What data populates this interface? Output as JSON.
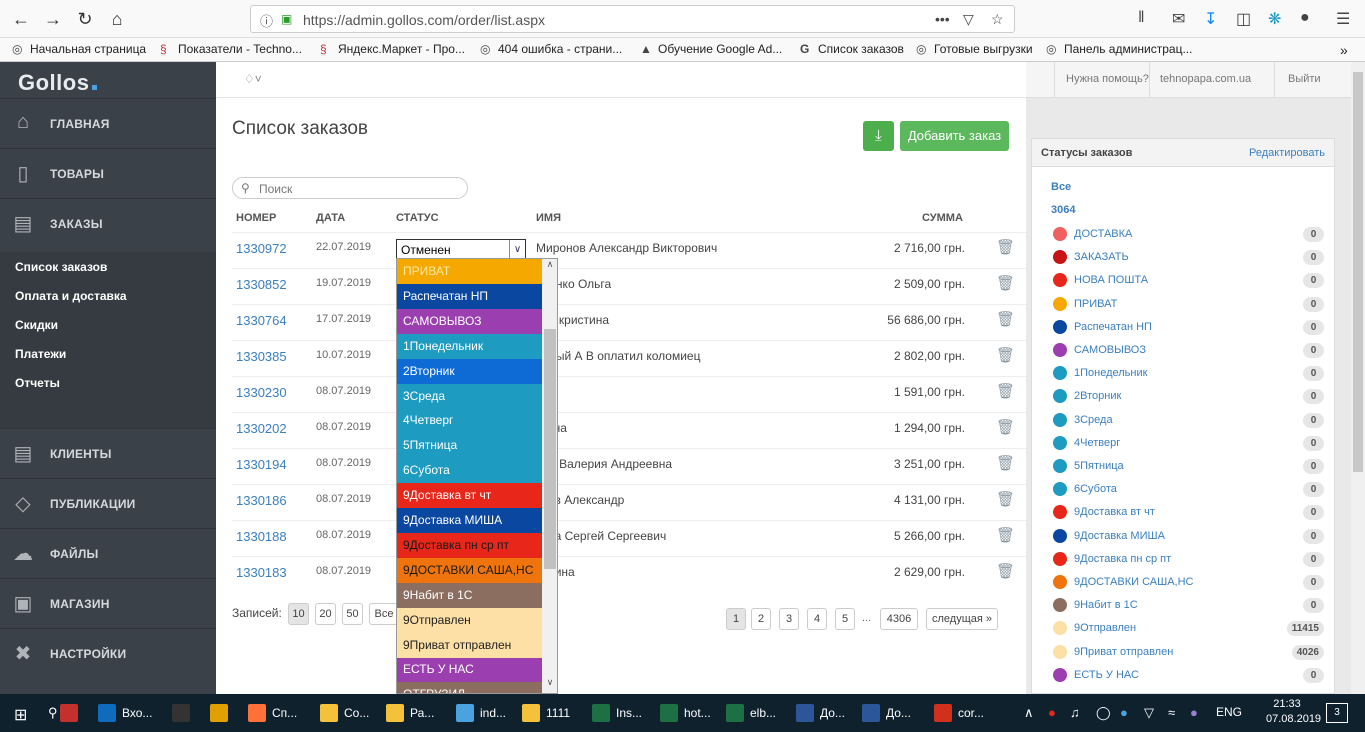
{
  "browser": {
    "url": "https://admin.gollos.com/order/list.aspx",
    "bookmarks": [
      {
        "label": "Начальная страница"
      },
      {
        "label": "Показатели - Techno..."
      },
      {
        "label": "Яндекс.Маркет - Про..."
      },
      {
        "label": "404 ошибка - страни..."
      },
      {
        "label": "Обучение Google Ad..."
      },
      {
        "label": "Список заказов"
      },
      {
        "label": "Готовые выгрузки"
      },
      {
        "label": "Панель администрац..."
      }
    ]
  },
  "sidebar": {
    "logo": "Gollos",
    "nav": [
      {
        "label": "ГЛАВНАЯ",
        "icon": "home-icon"
      },
      {
        "label": "ТОВАРЫ",
        "icon": "document-icon"
      },
      {
        "label": "ЗАКАЗЫ",
        "icon": "cart-icon"
      },
      {
        "label": "КЛИЕНТЫ",
        "icon": "client-card-icon"
      },
      {
        "label": "ПУБЛИКАЦИИ",
        "icon": "tag-icon"
      },
      {
        "label": "ФАЙЛЫ",
        "icon": "cloud-icon"
      },
      {
        "label": "МАГАЗИН",
        "icon": "store-icon"
      },
      {
        "label": "НАСТРОЙКИ",
        "icon": "wrench-icon"
      }
    ],
    "subnav": [
      "Список заказов",
      "Оплата и доставка",
      "Скидки",
      "Платежи",
      "Отчеты"
    ]
  },
  "header": {
    "help": "Нужна помощь?",
    "site": "tehnopapa.com.ua",
    "logout": "Выйти"
  },
  "page": {
    "title": "Список заказов",
    "add_button": "Добавить заказ",
    "search_placeholder": "Поиск",
    "columns": [
      "НОМЕР",
      "ДАТА",
      "СТАТУС",
      "ИМЯ",
      "СУММА"
    ],
    "orders": [
      {
        "num": "1330972",
        "date": "22.07.2019",
        "name": "Миронов Александр Викторович",
        "sum": "2 716,00 грн."
      },
      {
        "num": "1330852",
        "date": "19.07.2019",
        "name": "дченко Ольга",
        "sum": "2 509,00 грн."
      },
      {
        "num": "1330764",
        "date": "17.07.2019",
        "name": "арь кристина",
        "sum": "56 686,00 грн."
      },
      {
        "num": "1330385",
        "date": "10.07.2019",
        "name": "льный А В оплатил коломиец",
        "sum": "2 802,00 грн."
      },
      {
        "num": "1330230",
        "date": "08.07.2019",
        "name": "ис",
        "sum": "1 591,00 грн."
      },
      {
        "num": "1330202",
        "date": "08.07.2019",
        "name": "ягина",
        "sum": "1 294,00 грн."
      },
      {
        "num": "1330194",
        "date": "08.07.2019",
        "name": "пан Валерия Андреевна",
        "sum": "3 251,00 грн."
      },
      {
        "num": "1330186",
        "date": "08.07.2019",
        "name": "яков Александр",
        "sum": "4 131,00 грн."
      },
      {
        "num": "1330188",
        "date": "08.07.2019",
        "name": "авка Сергей Сергеевич",
        "sum": "5 266,00 грн."
      },
      {
        "num": "1330183",
        "date": "08.07.2019",
        "name": "терина",
        "sum": "2 629,00 грн."
      }
    ],
    "selected_status": "Отменен",
    "dropdown_options": [
      {
        "label": "ПРИВАТ",
        "bg": "#f5a800",
        "fg": "#f5e8a8"
      },
      {
        "label": "Распечатан НП",
        "bg": "#0a47a0",
        "fg": "#ffffff"
      },
      {
        "label": "САМОВЫВОЗ",
        "bg": "#9b3fb0",
        "fg": "#ffffff"
      },
      {
        "label": "1Понедельник",
        "bg": "#1e9bc0",
        "fg": "#ffffff"
      },
      {
        "label": "2Вторник",
        "bg": "#0e6bd6",
        "fg": "#ffffff"
      },
      {
        "label": "3Среда",
        "bg": "#1e9bc0",
        "fg": "#ffffff"
      },
      {
        "label": "4Четверг",
        "bg": "#1e9bc0",
        "fg": "#ffffff"
      },
      {
        "label": "5Пятница",
        "bg": "#1e9bc0",
        "fg": "#ffffff"
      },
      {
        "label": "6Субота",
        "bg": "#1e9bc0",
        "fg": "#ffffff"
      },
      {
        "label": "9Доставка вт чт",
        "bg": "#e8261a",
        "fg": "#ffffff"
      },
      {
        "label": "9Доставка МИША",
        "bg": "#0a47a0",
        "fg": "#ffffff"
      },
      {
        "label": "9Доставка пн ср пт",
        "bg": "#e8261a",
        "fg": "#1a1a1a"
      },
      {
        "label": "9ДОСТАВКИ САША,НС",
        "bg": "#f0740e",
        "fg": "#1a1a1a"
      },
      {
        "label": "9Набит в 1С",
        "bg": "#8c6e60",
        "fg": "#ffffff"
      },
      {
        "label": "9Отправлен",
        "bg": "#fde0a6",
        "fg": "#222222"
      },
      {
        "label": "9Приват отправлен",
        "bg": "#fde0a6",
        "fg": "#222222"
      },
      {
        "label": "ЕСТЬ У НАС",
        "bg": "#9b3fb0",
        "fg": "#ffffff"
      },
      {
        "label": "ОТГРУЗИЛ",
        "bg": "#8c6e60",
        "fg": "#ffffff"
      }
    ],
    "records_label": "Записей:",
    "page_sizes": [
      "10",
      "20",
      "50",
      "Все"
    ],
    "pagination": [
      "1",
      "2",
      "3",
      "4",
      "5",
      "4306"
    ],
    "ellipsis": "...",
    "next": "следущая »"
  },
  "statuses": {
    "title": "Статусы заказов",
    "edit": "Редактировать",
    "all": "Все",
    "total": "3064",
    "items": [
      {
        "name": "ДОСТАВКА",
        "color": "#f06060",
        "count": "0"
      },
      {
        "name": "ЗАКАЗАТЬ",
        "color": "#c81414",
        "count": "0"
      },
      {
        "name": "НОВА ПОШТА",
        "color": "#e8261a",
        "count": "0"
      },
      {
        "name": "ПРИВАТ",
        "color": "#f5a800",
        "count": "0"
      },
      {
        "name": "Распечатан НП",
        "color": "#0a47a0",
        "count": "0"
      },
      {
        "name": "САМОВЫВОЗ",
        "color": "#9b3fb0",
        "count": "0"
      },
      {
        "name": "1Понедельник",
        "color": "#1e9bc0",
        "count": "0"
      },
      {
        "name": "2Вторник",
        "color": "#1e9bc0",
        "count": "0"
      },
      {
        "name": "3Среда",
        "color": "#1e9bc0",
        "count": "0"
      },
      {
        "name": "4Четверг",
        "color": "#1e9bc0",
        "count": "0"
      },
      {
        "name": "5Пятница",
        "color": "#1e9bc0",
        "count": "0"
      },
      {
        "name": "6Субота",
        "color": "#1e9bc0",
        "count": "0"
      },
      {
        "name": "9Доставка вт чт",
        "color": "#e8261a",
        "count": "0"
      },
      {
        "name": "9Доставка МИША",
        "color": "#0a47a0",
        "count": "0"
      },
      {
        "name": "9Доставка пн ср пт",
        "color": "#e8261a",
        "count": "0"
      },
      {
        "name": "9ДОСТАВКИ САША,НС",
        "color": "#f0740e",
        "count": "0"
      },
      {
        "name": "9Набит в 1С",
        "color": "#8c6e60",
        "count": "0"
      },
      {
        "name": "9Отправлен",
        "color": "#fde0a6",
        "count": "11415"
      },
      {
        "name": "9Приват отправлен",
        "color": "#fde0a6",
        "count": "4026"
      },
      {
        "name": "ЕСТЬ У НАС",
        "color": "#9b3fb0",
        "count": "0"
      }
    ]
  },
  "taskbar": {
    "apps": [
      {
        "label": "",
        "icon": "mail-app-icon",
        "color": "#c4302b"
      },
      {
        "label": "Вхо...",
        "icon": "outlook-icon",
        "color": "#0f6cbd"
      },
      {
        "label": "",
        "icon": "calculator-icon",
        "color": "#333333"
      },
      {
        "label": "",
        "icon": "tools-icon",
        "color": "#e0a000"
      },
      {
        "label": "Сп...",
        "icon": "firefox-icon",
        "color": "#ff7139"
      },
      {
        "label": "Co...",
        "icon": "folder-icon",
        "color": "#f3c13a"
      },
      {
        "label": "Ра...",
        "icon": "folder-icon",
        "color": "#f3c13a"
      },
      {
        "label": "ind...",
        "icon": "cube-icon",
        "color": "#4aa3df"
      },
      {
        "label": "1111",
        "icon": "folder-icon",
        "color": "#f3c13a"
      },
      {
        "label": "Ins...",
        "icon": "excel-icon",
        "color": "#1d7044"
      },
      {
        "label": "hot...",
        "icon": "excel-icon",
        "color": "#1d7044"
      },
      {
        "label": "elb...",
        "icon": "excel-icon",
        "color": "#1d7044"
      },
      {
        "label": "До...",
        "icon": "word-icon",
        "color": "#2b579a"
      },
      {
        "label": "До...",
        "icon": "word-icon",
        "color": "#2b579a"
      },
      {
        "label": "cor...",
        "icon": "pdf-icon",
        "color": "#d0301c"
      }
    ],
    "lang": "ENG",
    "time": "21:33",
    "date": "07.08.2019",
    "notifications": "3"
  }
}
